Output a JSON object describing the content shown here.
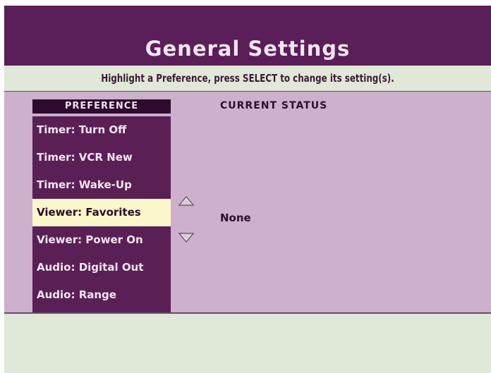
{
  "title": "General Settings",
  "instruction": "Highlight a Preference, press SELECT to change its setting(s).",
  "columns": {
    "preference": "PREFERENCE",
    "current_status": "CURRENT STATUS"
  },
  "preferences": [
    {
      "label": "Timer: Turn Off",
      "selected": false
    },
    {
      "label": "Timer: VCR New",
      "selected": false
    },
    {
      "label": "Timer: Wake-Up",
      "selected": false
    },
    {
      "label": "Viewer: Favorites",
      "selected": true
    },
    {
      "label": "Viewer: Power On",
      "selected": false
    },
    {
      "label": "Audio: Digital Out",
      "selected": false
    },
    {
      "label": "Audio: Range",
      "selected": false
    }
  ],
  "current_status_value": "None",
  "icons": {
    "up": "chevron-up-icon",
    "down": "chevron-down-icon"
  },
  "colors": {
    "title_bar": "#5a1e58",
    "instruction_bar": "#e0e8d8",
    "content_bg": "#ccb0cc",
    "list_bg": "#5a2055",
    "selected_bg": "#fbf7c8",
    "header_bg": "#2e0a2e"
  }
}
